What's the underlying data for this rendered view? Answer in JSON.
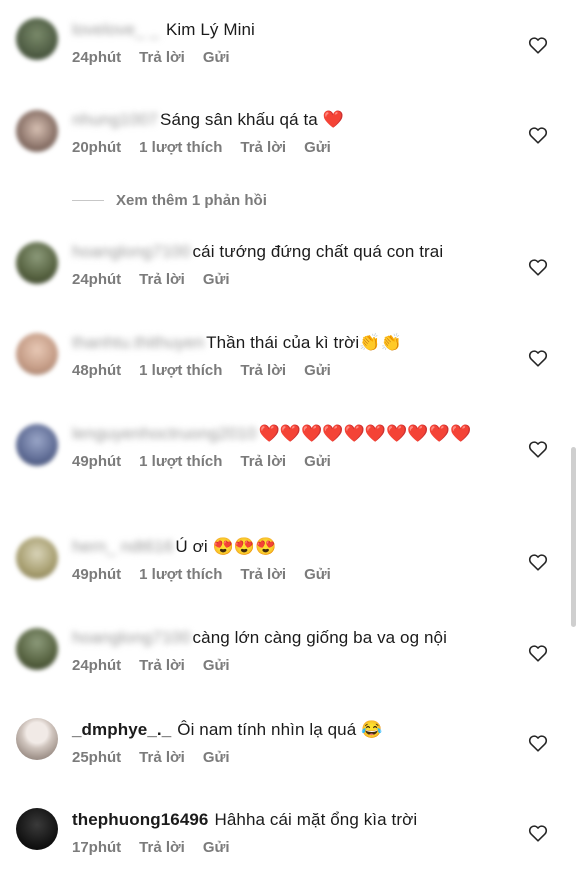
{
  "comments": [
    {
      "username": "lovelove_ _ ",
      "text": "Kim Lý Mini",
      "time": "24phút",
      "likes": "",
      "reply": "Trả lời",
      "send": "Gửi"
    },
    {
      "username": "nhung1007",
      "text": "Sáng sân khấu qá ta ❤️",
      "time": "20phút",
      "likes": "1 lượt thích",
      "reply": "Trả lời",
      "send": "Gửi"
    },
    {
      "username": "hoanglong7100",
      "text": "cái tướng đứng chất quá con trai",
      "time": "24phút",
      "likes": "",
      "reply": "Trả lời",
      "send": "Gửi"
    },
    {
      "username": "thanhtu.thithuyen",
      "text": "Thần thái của kì trời👏👏",
      "time": "48phút",
      "likes": "1 lượt thích",
      "reply": "Trả lời",
      "send": "Gửi"
    },
    {
      "username": "lenguyenhoctruong2010",
      "text": "❤️❤️❤️❤️❤️❤️❤️❤️❤️❤️",
      "time": "49phút",
      "likes": "1 lượt thích",
      "reply": "Trả lời",
      "send": "Gửi"
    },
    {
      "username": "hern_ ndt616",
      "text": "Ú ơi 😍😍😍",
      "time": "49phút",
      "likes": "1 lượt thích",
      "reply": "Trả lời",
      "send": "Gửi"
    },
    {
      "username": "hoanglong7100",
      "text": "càng lớn càng giống ba va og nội",
      "time": "24phút",
      "likes": "",
      "reply": "Trả lời",
      "send": "Gửi"
    },
    {
      "username": "_dmphye_._",
      "text": "Ôi nam tính nhìn lạ quá 😂",
      "time": "25phút",
      "likes": "",
      "reply": "Trả lời",
      "send": "Gửi"
    },
    {
      "username": "thephuong16496",
      "text": "Hâhha cái mặt ổng kìa trời",
      "time": "17phút",
      "likes": "",
      "reply": "Trả lời",
      "send": "Gửi"
    }
  ],
  "view_more_replies": "Xem thêm 1 phản hồi",
  "icons": {
    "like": "heart-outline-icon"
  },
  "colors": {
    "meta_text": "#7b7b7b",
    "text": "#1b1b1b",
    "background": "#ffffff"
  }
}
